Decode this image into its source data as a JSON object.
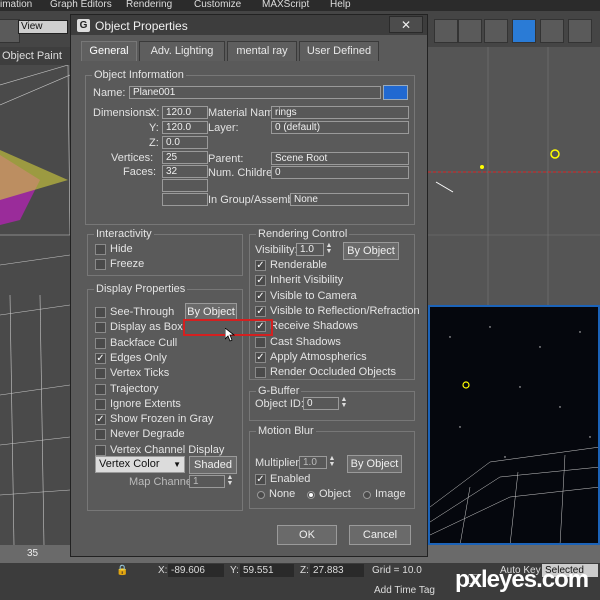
{
  "menubar": {
    "items": [
      "imation",
      "Graph Editors",
      "Rendering",
      "Customize",
      "MAXScript",
      "Help"
    ]
  },
  "toolbar": {
    "view_select": "View"
  },
  "object_paint_label": "Object Paint",
  "dialog": {
    "title": "Object Properties",
    "tabs": [
      "General",
      "Adv. Lighting",
      "mental ray",
      "User Defined"
    ],
    "object_info": {
      "title": "Object Information",
      "name_label": "Name:",
      "name_value": "Plane001",
      "dimensions_label": "Dimensions:",
      "x_label": "X:",
      "x_value": "120.0",
      "y_label": "Y:",
      "y_value": "120.0",
      "z_label": "Z:",
      "z_value": "0.0",
      "vertices_label": "Vertices:",
      "vertices_value": "25",
      "faces_label": "Faces:",
      "faces_value": "32",
      "material_label": "Material Name:",
      "material_value": "rings",
      "layer_label": "Layer:",
      "layer_value": "0 (default)",
      "parent_label": "Parent:",
      "parent_value": "Scene Root",
      "children_label": "Num. Children:",
      "children_value": "0",
      "group_label": "In Group/Assembly:",
      "group_value": "None",
      "color": "#2169d1"
    },
    "interactivity": {
      "title": "Interactivity",
      "hide": "Hide",
      "freeze": "Freeze"
    },
    "display": {
      "title": "Display Properties",
      "by_object": "By Object",
      "items": [
        {
          "label": "See-Through",
          "checked": false
        },
        {
          "label": "Display as Box",
          "checked": false
        },
        {
          "label": "Backface Cull",
          "checked": false
        },
        {
          "label": "Edges Only",
          "checked": true
        },
        {
          "label": "Vertex Ticks",
          "checked": false
        },
        {
          "label": "Trajectory",
          "checked": false
        },
        {
          "label": "Ignore Extents",
          "checked": false
        },
        {
          "label": "Show Frozen in Gray",
          "checked": true
        },
        {
          "label": "Never Degrade",
          "checked": false
        },
        {
          "label": "Vertex Channel Display",
          "checked": false
        }
      ],
      "vertex_color": "Vertex Color",
      "shaded": "Shaded",
      "map_channel_label": "Map Channel:",
      "map_channel_value": "1"
    },
    "rendering": {
      "title": "Rendering Control",
      "visibility_label": "Visibility:",
      "visibility_value": "1.0",
      "by_object": "By Object",
      "items": [
        {
          "label": "Renderable",
          "checked": true
        },
        {
          "label": "Inherit Visibility",
          "checked": true
        },
        {
          "label": "Visible to Camera",
          "checked": true
        },
        {
          "label": "Visible to Reflection/Refraction",
          "checked": true
        },
        {
          "label": "Receive Shadows",
          "checked": true
        },
        {
          "label": "Cast Shadows",
          "checked": false
        },
        {
          "label": "Apply Atmospherics",
          "checked": true
        },
        {
          "label": "Render Occluded Objects",
          "checked": false
        }
      ]
    },
    "gbuffer": {
      "title": "G-Buffer",
      "object_id_label": "Object ID:",
      "object_id_value": "0"
    },
    "motion_blur": {
      "title": "Motion Blur",
      "multiplier_label": "Multiplier:",
      "multiplier_value": "1.0",
      "by_object": "By Object",
      "enabled": "Enabled",
      "none": "None",
      "object": "Object",
      "image": "Image"
    },
    "ok": "OK",
    "cancel": "Cancel"
  },
  "timeline": {
    "tick": "35"
  },
  "status": {
    "x_label": "X:",
    "x_value": "-89.606",
    "y_label": "Y:",
    "y_value": "59.551",
    "z_label": "Z:",
    "z_value": "27.883",
    "grid": "Grid = 10.0",
    "add_time_tag": "Add Time Tag",
    "auto_key": "Auto Key",
    "selected": "Selected"
  },
  "watermark": "pxleyes.com"
}
